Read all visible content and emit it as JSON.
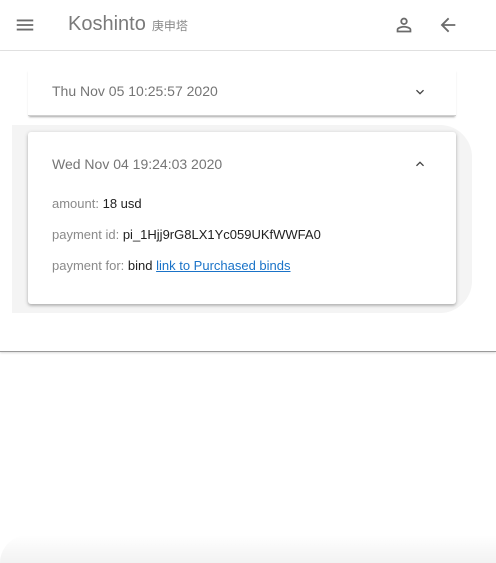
{
  "appbar": {
    "title": "Koshinto",
    "subtitle": "庚申塔",
    "menu_icon": "menu-icon",
    "account_icon": "account-icon",
    "back_icon": "arrow-back-icon"
  },
  "payments": [
    {
      "date": "Thu Nov 05 10:25:57 2020",
      "expanded": false
    },
    {
      "date": "Wed Nov 04 19:24:03 2020",
      "expanded": true,
      "amount_label": "amount:",
      "amount_value": "18 usd",
      "payment_id_label": "payment id:",
      "payment_id_value": "pi_1Hjj9rG8LX1Yc059UKfWWFA0",
      "payment_for_label": "payment for:",
      "payment_for_value": "bind",
      "link_text": "link to Purchased binds"
    }
  ],
  "colors": {
    "link": "#1a73c8",
    "label": "#8a8a8a",
    "expanded_background": "#f4f4f4"
  }
}
